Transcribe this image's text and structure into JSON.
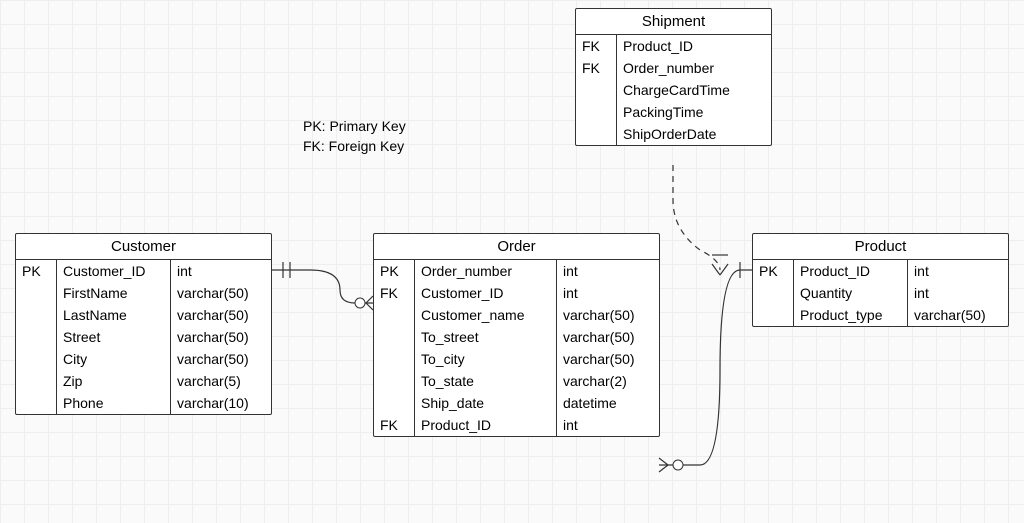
{
  "legend": {
    "pk": "PK: Primary Key",
    "fk": "FK: Foreign Key"
  },
  "entities": {
    "customer": {
      "title": "Customer",
      "rows": [
        {
          "key": "PK",
          "name": "Customer_ID",
          "type": "int"
        },
        {
          "key": "",
          "name": "FirstName",
          "type": "varchar(50)"
        },
        {
          "key": "",
          "name": "LastName",
          "type": "varchar(50)"
        },
        {
          "key": "",
          "name": "Street",
          "type": "varchar(50)"
        },
        {
          "key": "",
          "name": "City",
          "type": "varchar(50)"
        },
        {
          "key": "",
          "name": "Zip",
          "type": "varchar(5)"
        },
        {
          "key": "",
          "name": "Phone",
          "type": "varchar(10)"
        }
      ]
    },
    "order": {
      "title": "Order",
      "rows": [
        {
          "key": "PK",
          "name": "Order_number",
          "type": "int"
        },
        {
          "key": "FK",
          "name": "Customer_ID",
          "type": "int"
        },
        {
          "key": "",
          "name": "Customer_name",
          "type": "varchar(50)"
        },
        {
          "key": "",
          "name": "To_street",
          "type": "varchar(50)"
        },
        {
          "key": "",
          "name": "To_city",
          "type": "varchar(50)"
        },
        {
          "key": "",
          "name": "To_state",
          "type": "varchar(2)"
        },
        {
          "key": "",
          "name": "Ship_date",
          "type": "datetime"
        },
        {
          "key": "FK",
          "name": "Product_ID",
          "type": "int"
        }
      ]
    },
    "product": {
      "title": "Product",
      "rows": [
        {
          "key": "PK",
          "name": "Product_ID",
          "type": "int"
        },
        {
          "key": "",
          "name": "Quantity",
          "type": "int"
        },
        {
          "key": "",
          "name": "Product_type",
          "type": "varchar(50)"
        }
      ]
    },
    "shipment": {
      "title": "Shipment",
      "rows": [
        {
          "key": "FK",
          "name": "Product_ID"
        },
        {
          "key": "FK",
          "name": "Order_number"
        },
        {
          "key": "",
          "name": "ChargeCardTime"
        },
        {
          "key": "",
          "name": "PackingTime"
        },
        {
          "key": "",
          "name": "ShipOrderDate"
        }
      ]
    }
  },
  "chart_data": {
    "type": "erd",
    "entities": [
      "Customer",
      "Order",
      "Product",
      "Shipment"
    ],
    "relationships": [
      {
        "from": "Customer",
        "to": "Order",
        "via": "Customer_ID"
      },
      {
        "from": "Order",
        "to": "Product",
        "via": "Product_ID"
      },
      {
        "from": "Shipment",
        "to": "Order",
        "via": "Order_number"
      },
      {
        "from": "Shipment",
        "to": "Product",
        "via": "Product_ID"
      }
    ]
  }
}
